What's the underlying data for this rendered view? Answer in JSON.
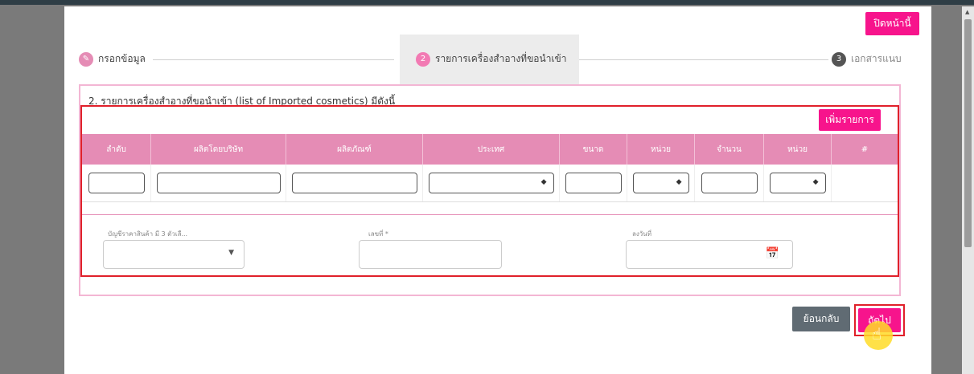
{
  "dialog": {
    "close_label": "ปิดหน้านี้"
  },
  "stepper": {
    "steps": [
      {
        "number": "",
        "label": "กรอกข้อมูล"
      },
      {
        "number": "2",
        "label": "รายการเครื่องสำอางที่ขอนำเข้า"
      },
      {
        "number": "3",
        "label": "เอกสารแนบ"
      }
    ]
  },
  "section": {
    "title": "2. รายการเครื่องสำอางที่ขอนำเข้า (list of Imported cosmetics) มีดังนี้",
    "add_label": "เพิ่มรายการ"
  },
  "table": {
    "headers": [
      "ลำดับ",
      "ผลิตโดยบริษัท",
      "ผลิตภัณฑ์",
      "ประเทศ",
      "ขนาด",
      "หน่วย",
      "จำนวน",
      "หน่วย",
      "#"
    ]
  },
  "form": {
    "tariff_label": "บัญชีราคาสินค้า มี 3 ตัวเลื...",
    "number_label": "เลขที่ *",
    "date_label": "ลงวันที่"
  },
  "actions": {
    "back_label": "ย้อนกลับ",
    "next_label": "ถัดไป"
  },
  "colors": {
    "pink": "#f7148c",
    "header": "#e58cb5",
    "highlight": "#e0202a"
  }
}
